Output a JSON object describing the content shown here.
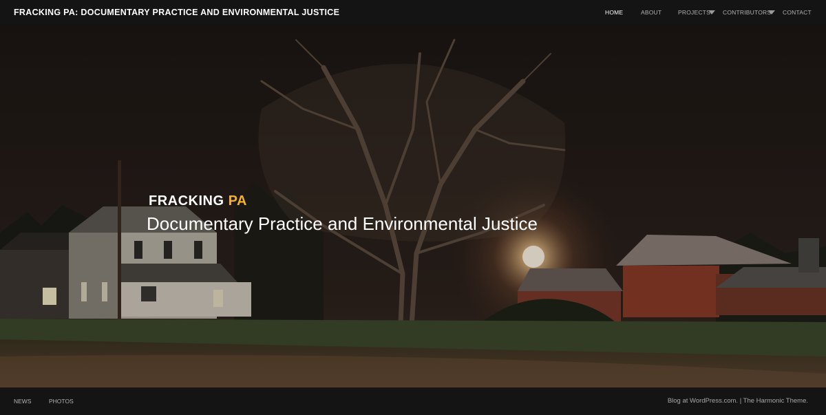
{
  "header": {
    "site_title": "FRACKING PA: DOCUMENTARY PRACTICE AND ENVIRONMENTAL JUSTICE",
    "nav": [
      {
        "label": "HOME",
        "active": true
      },
      {
        "label": "ABOUT"
      },
      {
        "label": "PROJECTS",
        "has_dropdown": true
      },
      {
        "label": "CONTRIBUTORS",
        "has_dropdown": true
      },
      {
        "label": "CONTACT"
      }
    ]
  },
  "hero": {
    "logo_part1": "FRACKING",
    "logo_part2": "PA",
    "tagline": "Documentary Practice and Environmental Justice"
  },
  "footer": {
    "links": [
      "NEWS",
      "PHOTOS"
    ],
    "credit_part1": "Blog at WordPress.com.",
    "credit_separator": " | ",
    "credit_part2": "The Harmonic Theme."
  },
  "colors": {
    "background": "#141414",
    "accent": "#f4b22b",
    "text": "#ffffff",
    "nav_text": "#b3b3b3"
  }
}
